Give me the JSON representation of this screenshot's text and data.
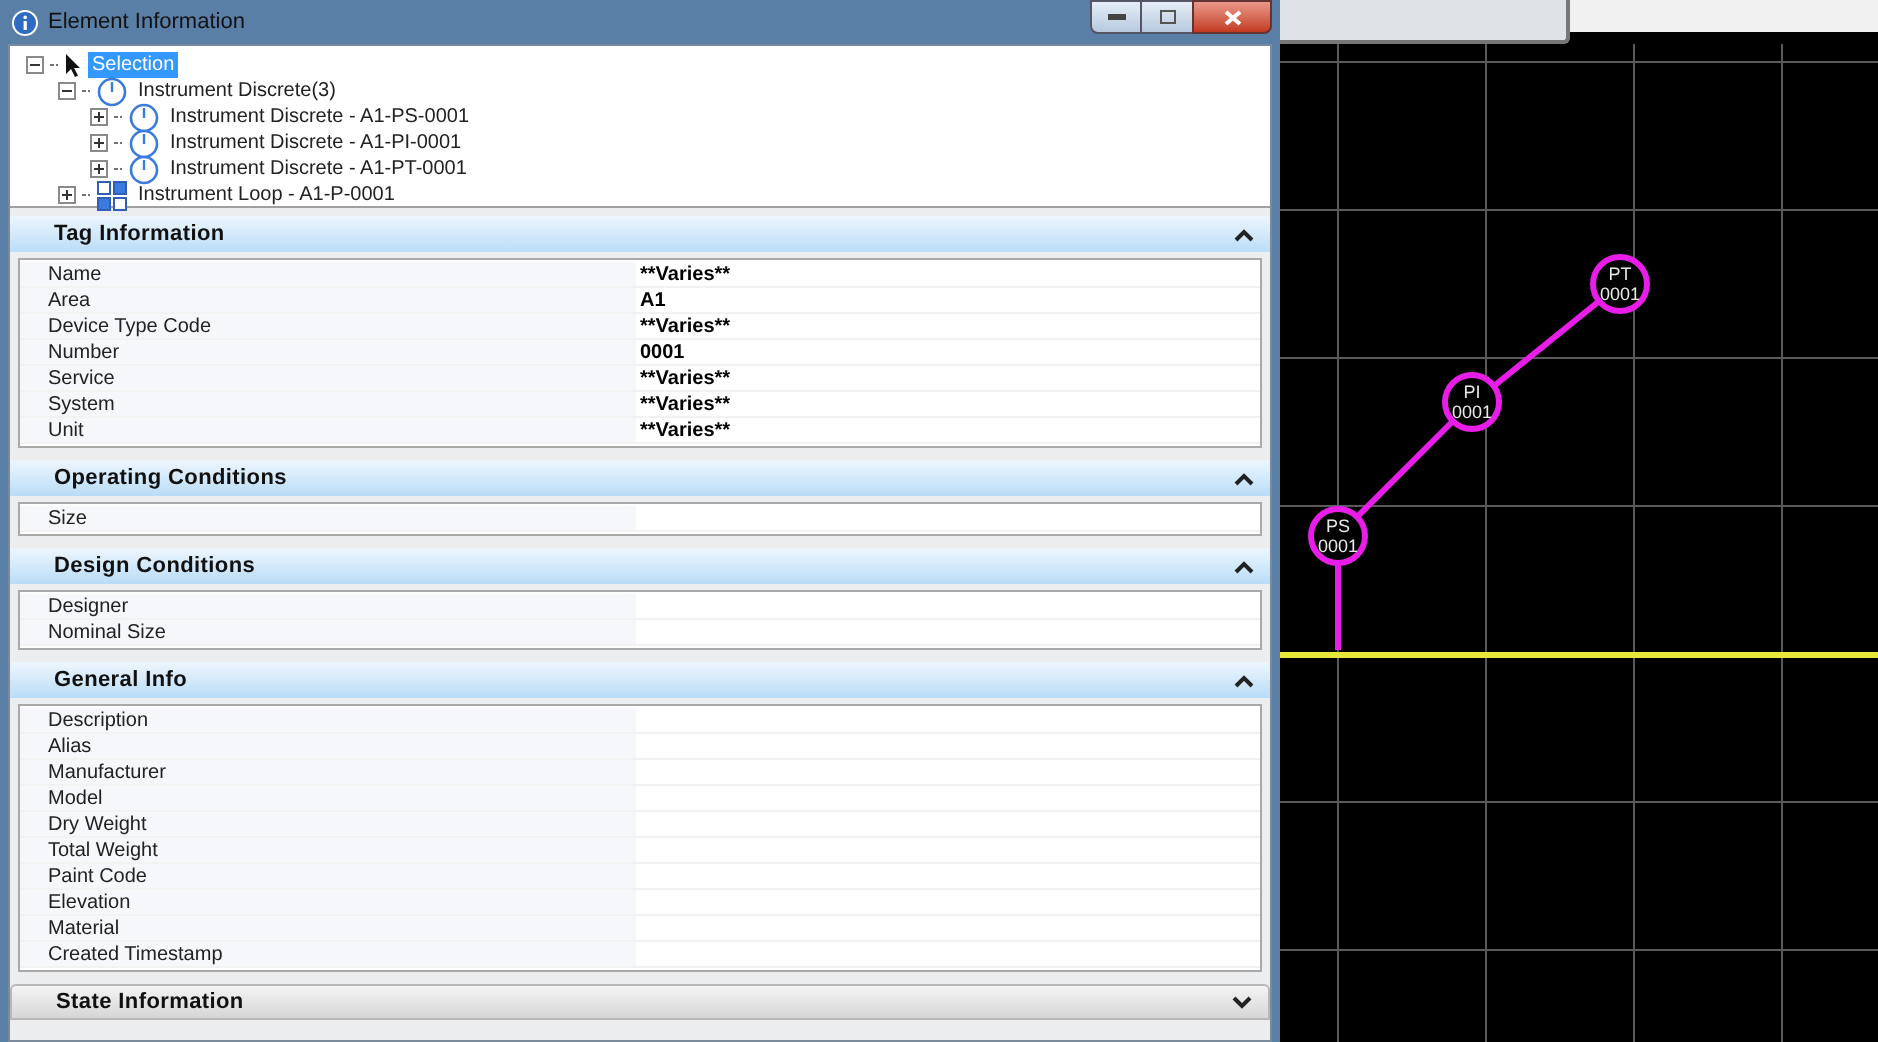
{
  "window": {
    "title": "Element Information"
  },
  "tree": [
    {
      "kind": "selection",
      "label": "Selection",
      "selected": true,
      "expanded": true,
      "children": [
        {
          "kind": "instrument",
          "label": "Instrument Discrete(3)",
          "selected": false,
          "expanded": true,
          "children": [
            {
              "kind": "instrument",
              "label": "Instrument Discrete - A1-PS-0001",
              "selected": false,
              "expanded": false
            },
            {
              "kind": "instrument",
              "label": "Instrument Discrete - A1-PI-0001",
              "selected": false,
              "expanded": false
            },
            {
              "kind": "instrument",
              "label": "Instrument Discrete - A1-PT-0001",
              "selected": false,
              "expanded": false
            }
          ]
        },
        {
          "kind": "loop",
          "label": "Instrument Loop - A1-P-0001",
          "selected": false,
          "expanded": false
        }
      ]
    }
  ],
  "sections": [
    {
      "title": "Tag Information",
      "expanded": true,
      "rows": [
        {
          "label": "Name",
          "value": "**Varies**"
        },
        {
          "label": "Area",
          "value": "A1"
        },
        {
          "label": "Device Type Code",
          "value": "**Varies**"
        },
        {
          "label": "Number",
          "value": "0001"
        },
        {
          "label": "Service",
          "value": "**Varies**"
        },
        {
          "label": "System",
          "value": "**Varies**"
        },
        {
          "label": "Unit",
          "value": "**Varies**"
        }
      ]
    },
    {
      "title": "Operating Conditions",
      "expanded": true,
      "rows": [
        {
          "label": "Size"
        }
      ]
    },
    {
      "title": "Design Conditions",
      "expanded": true,
      "rows": [
        {
          "label": "Designer"
        },
        {
          "label": "Nominal Size"
        }
      ]
    },
    {
      "title": "General Info",
      "expanded": true,
      "rows": [
        {
          "label": "Description"
        },
        {
          "label": "Alias"
        },
        {
          "label": "Manufacturer"
        },
        {
          "label": "Model"
        },
        {
          "label": "Dry Weight"
        },
        {
          "label": "Total Weight"
        },
        {
          "label": "Paint Code"
        },
        {
          "label": "Elevation"
        },
        {
          "label": "Material"
        },
        {
          "label": "Created Timestamp"
        }
      ]
    },
    {
      "title": "State Information",
      "expanded": false
    }
  ],
  "canvas": {
    "nodes": [
      {
        "code": "PS",
        "number": "0001"
      },
      {
        "code": "PI",
        "number": "0001"
      },
      {
        "code": "PT",
        "number": "0001"
      }
    ]
  }
}
